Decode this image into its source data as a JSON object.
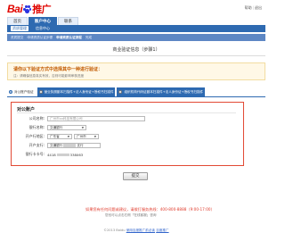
{
  "brand": {
    "logo_left": "Bai",
    "logo_right": "推广"
  },
  "header": {
    "links": [
      "帮助",
      "退出"
    ],
    "tabs": [
      {
        "label": "首页",
        "active": false
      },
      {
        "label": "账户中心",
        "active": true
      },
      {
        "label": "联系",
        "active": false
      }
    ]
  },
  "subnav": {
    "items": [
      {
        "label": "资质管理",
        "active": true
      },
      {
        "label": "信息中心",
        "active": false
      }
    ]
  },
  "breadcrumb": {
    "items": [
      {
        "label": "资质提交",
        "active": false
      },
      {
        "label": "申请资质认证步骤",
        "active": false
      },
      {
        "label": "申请资质认证流程",
        "active": true
      },
      {
        "label": "完成",
        "active": false
      }
    ]
  },
  "page_title": "商业验证信息（步骤1）",
  "notice": {
    "main": "请你以下验证方式中选择其中一种进行验证：",
    "sub": "注：请确保信息真实有效，否则可能影响审核进度"
  },
  "options": [
    {
      "label": "对公账户验证",
      "selected": true,
      "highlight": false
    },
    {
      "label": "营业执照副本扫描件+法人身份证+授权书扫描件",
      "selected": false,
      "highlight": true
    },
    {
      "label": "组织机构代码证副本扫描件+法人身份证+授权书扫描件",
      "selected": false,
      "highlight": true
    }
  ],
  "form": {
    "heading": "对公账户",
    "fields": {
      "company_name": {
        "label": "公司名称:",
        "placeholder": "广州市xx科技有限公司"
      },
      "bank": {
        "label": "银行名称:",
        "value": "交通银行"
      },
      "location": {
        "label": "开户行地区:",
        "province": "广东省",
        "city": "广州市"
      },
      "branch": {
        "label": "开户支行:",
        "prefix": "交通银行",
        "suffix": "支行"
      },
      "account": {
        "label": "银行卡卡号:",
        "prefix": "4418",
        "suffix": "338063"
      }
    }
  },
  "submit_label": "提交",
  "hotline": "如果您有任何问题或建议，请拨打服务热线：400-800-8888（9:00-17:00）",
  "hotline_sub": "您也可以点击右侧「在线客服」咨询",
  "footer": {
    "copyright": "©2013 Baidu",
    "links": [
      "使用百度推广前必读",
      "百度推广"
    ]
  },
  "colors": {
    "accent": "#2e6ab1",
    "alert": "#e03c2d",
    "notice_text": "#c25a00"
  }
}
